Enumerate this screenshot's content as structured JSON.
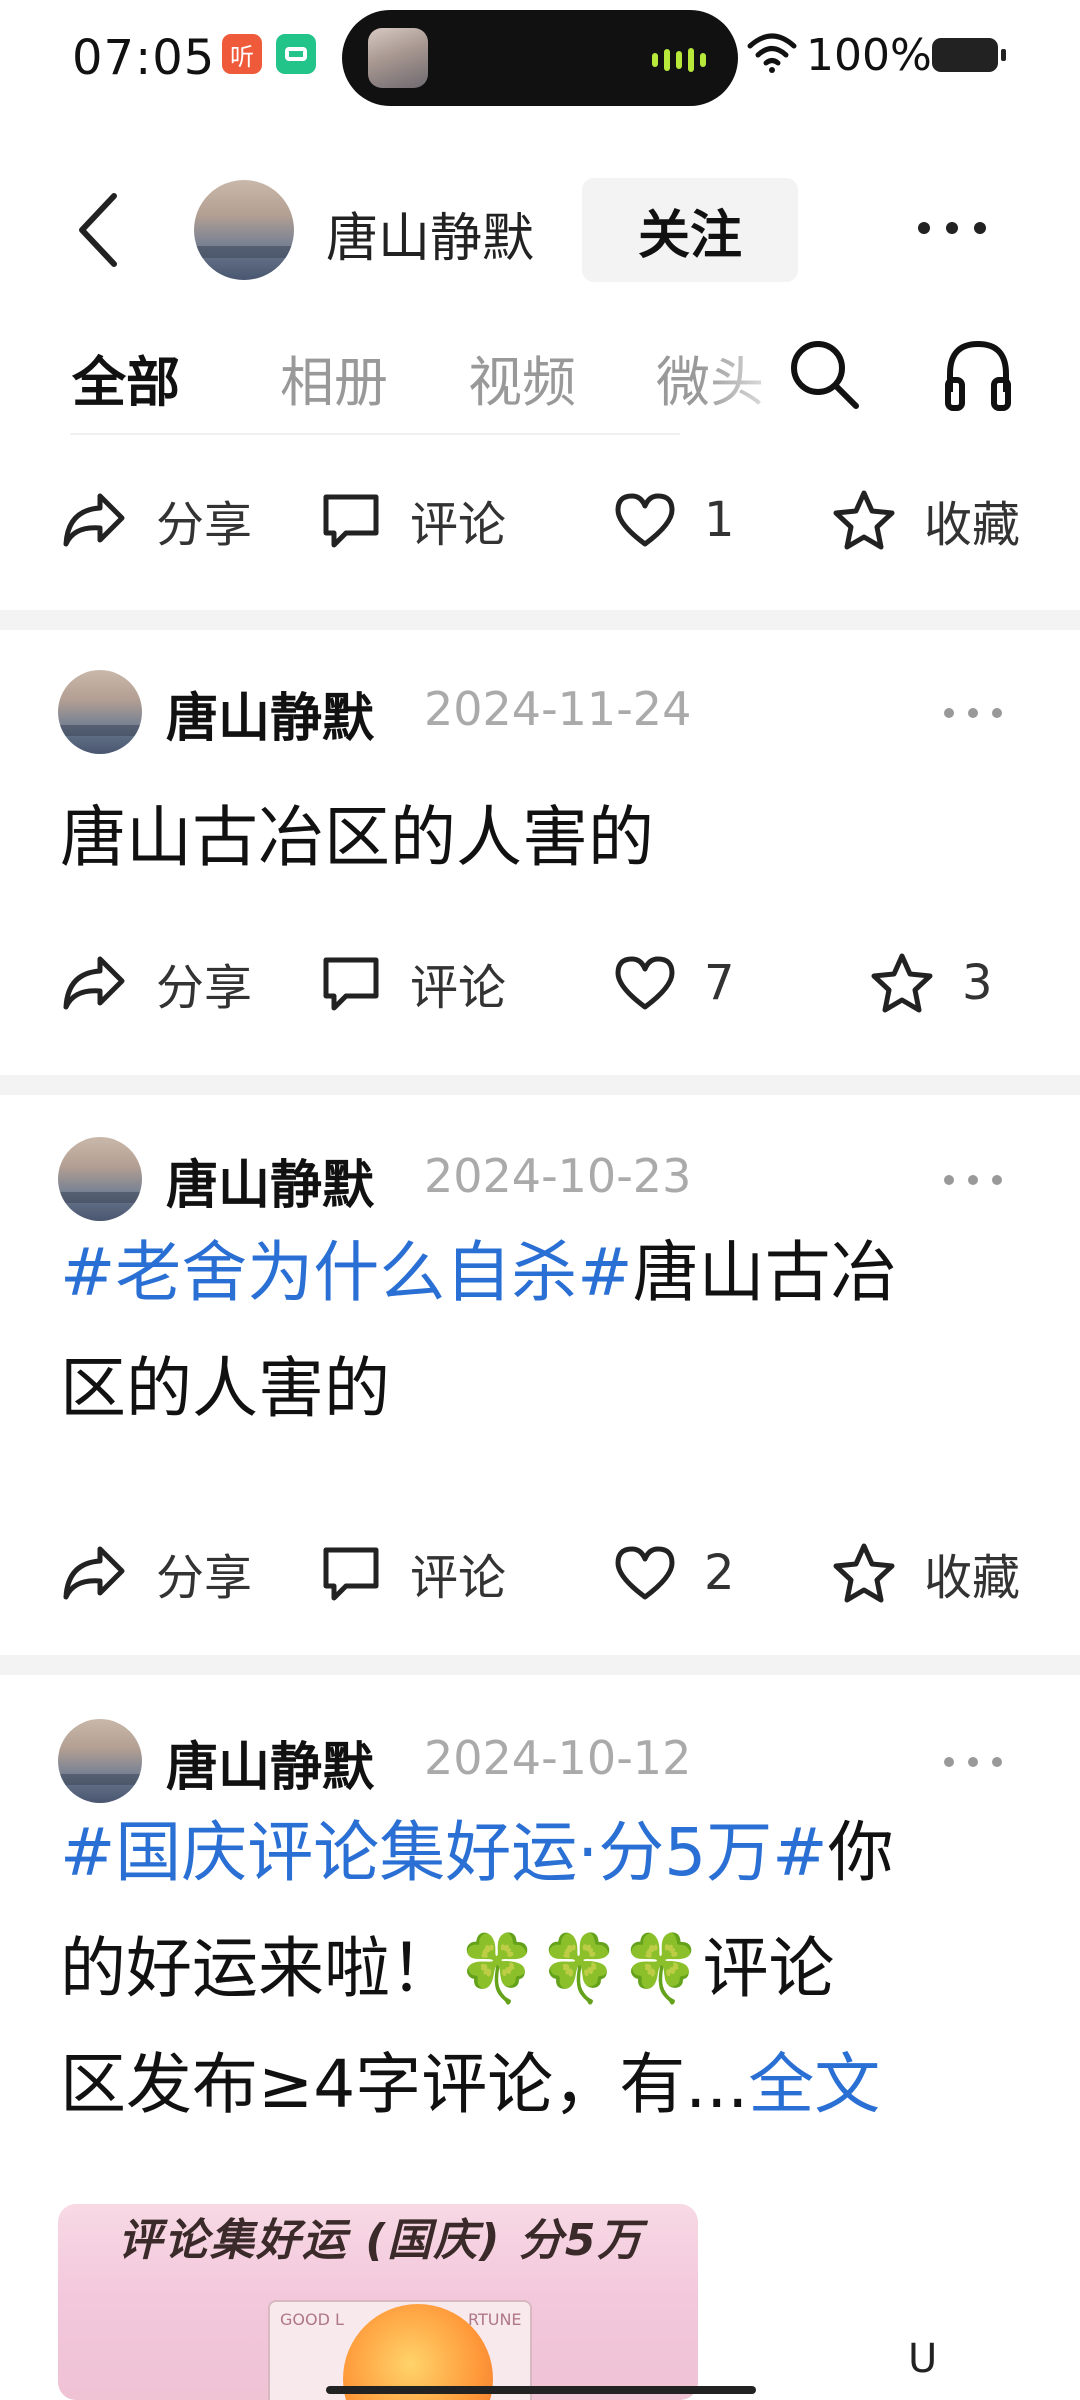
{
  "status_bar": {
    "time": "07:05",
    "app_badge_1": "听",
    "battery_text": "100%"
  },
  "header": {
    "username": "唐山静默",
    "follow_label": "关注"
  },
  "tabs": [
    {
      "label": "全部",
      "active": true
    },
    {
      "label": "相册",
      "active": false
    },
    {
      "label": "视频",
      "active": false
    },
    {
      "label": "微头",
      "active": false
    }
  ],
  "actions": {
    "share": "分享",
    "comment": "评论",
    "favorite": "收藏"
  },
  "top_bar": {
    "likes": "1",
    "favorite_label": "收藏"
  },
  "posts": [
    {
      "author": "唐山静默",
      "date": "2024-11-24",
      "text": "唐山古冶区的人害的",
      "likes": "7",
      "favorites": "3"
    },
    {
      "author": "唐山静默",
      "date": "2024-10-23",
      "topic": "#老舍为什么自杀#",
      "text_after_topic": "唐山古冶",
      "text_line2": "区的人害的",
      "likes": "2",
      "favorite_label": "收藏"
    },
    {
      "author": "唐山静默",
      "date": "2024-10-12",
      "topic": "#国庆评论集好运·分5万#",
      "text_after_topic": "你",
      "text_line2": "的好运来啦！🍀🍀🍀评论",
      "text_line3": "区发布≥4字评论，有...",
      "full_text_link": "全文",
      "image_title": "评论集好运 (国庆) 分5万",
      "image_card_left": "GOOD L",
      "image_card_right": "RTUNE"
    }
  ],
  "colors": {
    "topic_link": "#2a6fd4",
    "separator": "#f3f3f3",
    "date_gray": "#aaaaaa"
  },
  "icons": [
    "back-icon",
    "more-icon",
    "search-icon",
    "headphone-icon",
    "share-icon",
    "comment-icon",
    "heart-icon",
    "star-icon"
  ]
}
